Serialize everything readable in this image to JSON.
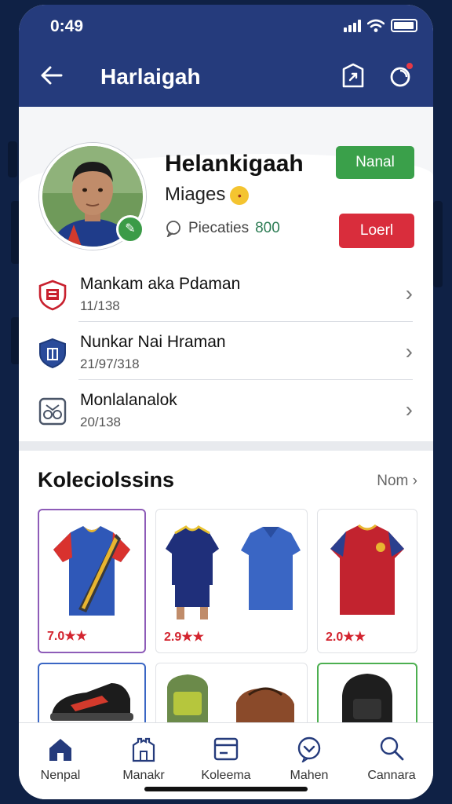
{
  "status": {
    "time": "0:49"
  },
  "header": {
    "title": "Harlaigah"
  },
  "profile": {
    "name": "Helankigaah",
    "subtitle": "Miages",
    "stat_label": "Piecaties",
    "stat_value": "800",
    "primary_button": "Nanal",
    "secondary_button": "Loerl",
    "colors": {
      "green": "#3aa04a",
      "red": "#d92d3c",
      "header": "#253b7c"
    }
  },
  "list": [
    {
      "title": "Mankam aka Pdaman",
      "sub": "11/138",
      "icon": "shield-emblem-red"
    },
    {
      "title": "Nunkar Nai Hraman",
      "sub": "21/97/318",
      "icon": "shield-emblem-blue"
    },
    {
      "title": "Monlalanalok",
      "sub": "20/138",
      "icon": "crest-emblem-gray"
    }
  ],
  "collection": {
    "title": "Koleciolssins",
    "more": "Nom",
    "items": [
      {
        "rating": "7.0★★",
        "kind": "jersey-with-scarf"
      },
      {
        "rating": "2.9★★",
        "kind": "kit-navy-and-polo-blue"
      },
      {
        "rating": "2.0★★",
        "kind": "jersey-red"
      },
      {
        "rating": "",
        "kind": "shoe"
      },
      {
        "rating": "",
        "kind": "bags"
      },
      {
        "rating": "",
        "kind": "backpack"
      }
    ]
  },
  "nav": [
    {
      "label": "Nenpal",
      "icon": "home-icon",
      "active": true
    },
    {
      "label": "Manakr",
      "icon": "stadium-icon",
      "active": false
    },
    {
      "label": "Koleema",
      "icon": "card-icon",
      "active": false
    },
    {
      "label": "Mahen",
      "icon": "heart-chat-icon",
      "active": false
    },
    {
      "label": "Cannara",
      "icon": "search-icon",
      "active": false
    }
  ]
}
